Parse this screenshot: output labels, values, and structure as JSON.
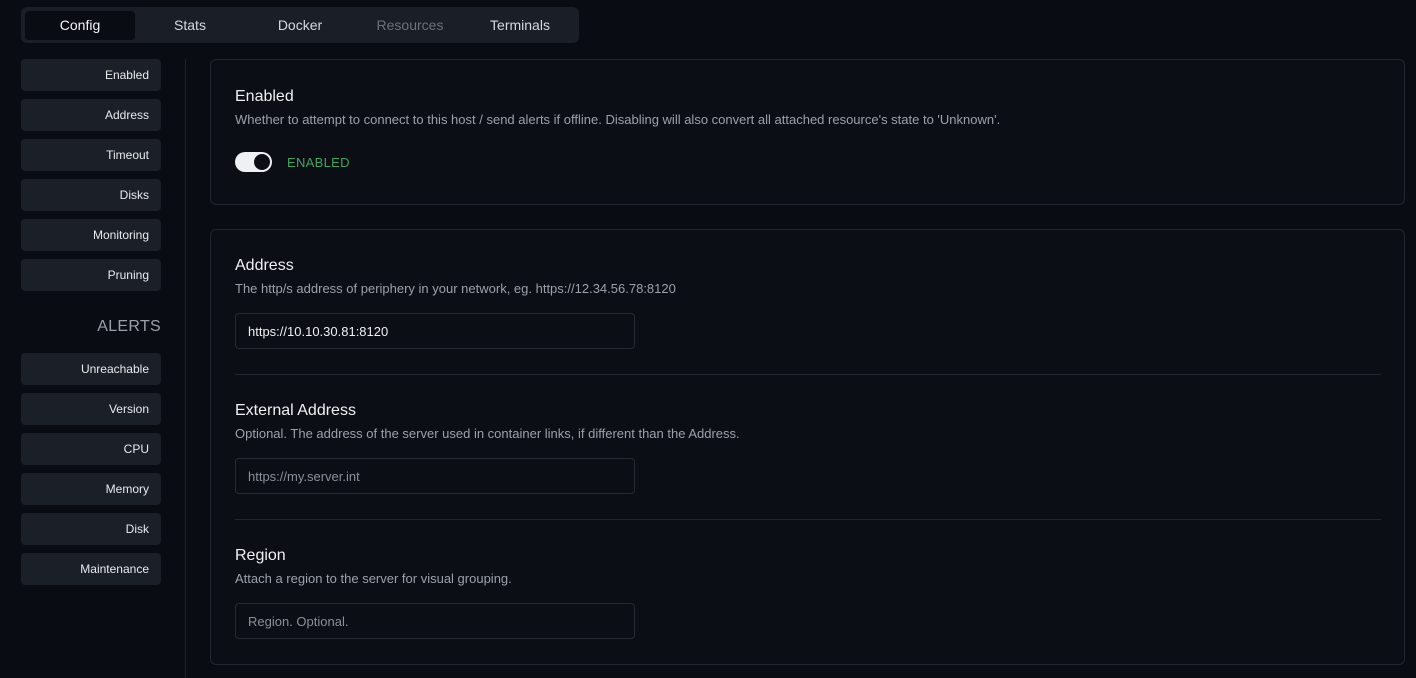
{
  "tabs": [
    {
      "label": "Config",
      "state": "active"
    },
    {
      "label": "Stats",
      "state": "normal"
    },
    {
      "label": "Docker",
      "state": "normal"
    },
    {
      "label": "Resources",
      "state": "disabled"
    },
    {
      "label": "Terminals",
      "state": "normal"
    }
  ],
  "sidebar": {
    "config_items": [
      "Enabled",
      "Address",
      "Timeout",
      "Disks",
      "Monitoring",
      "Pruning"
    ],
    "alerts_heading": "ALERTS",
    "alert_items": [
      "Unreachable",
      "Version",
      "CPU",
      "Memory",
      "Disk",
      "Maintenance"
    ]
  },
  "enabled": {
    "title": "Enabled",
    "description": "Whether to attempt to connect to this host / send alerts if offline. Disabling will also convert all attached resource's state to 'Unknown'.",
    "toggle_on": true,
    "status_label": "ENABLED"
  },
  "address": {
    "title": "Address",
    "description": "The http/s address of periphery in your network, eg. https://12.34.56.78:8120",
    "value": "https://10.10.30.81:8120",
    "placeholder": ""
  },
  "external_address": {
    "title": "External Address",
    "description": "Optional. The address of the server used in container links, if different than the Address.",
    "value": "",
    "placeholder": "https://my.server.int"
  },
  "region": {
    "title": "Region",
    "description": "Attach a region to the server for visual grouping.",
    "value": "",
    "placeholder": "Region. Optional."
  },
  "colors": {
    "background": "#090c12",
    "panel": "#1b1f28",
    "enabled_green": "#3fa45f"
  }
}
